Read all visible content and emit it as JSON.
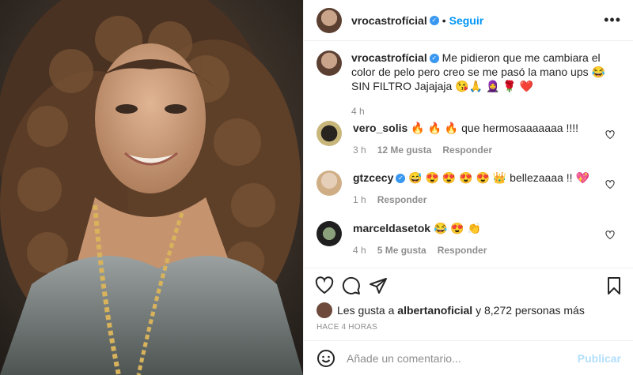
{
  "post": {
    "author": "vrocastrofícial",
    "follow_label": "Seguir",
    "dot": "•",
    "more": "•••"
  },
  "caption": {
    "username": "vrocastrofícial",
    "text": "Me pidieron que me cambiara el color de pelo pero creo se me pasó la mano ups 😂 SIN FILTRO Jajajaja 😘🙏 🧕 🌹 ❤️",
    "time": "4 h"
  },
  "comments": [
    {
      "username": "vero_solis",
      "text": "🔥 🔥 🔥  que hermosaaaaaaa !!!!",
      "time": "3 h",
      "likes": "12 Me gusta",
      "reply": "Responder"
    },
    {
      "username": "gtzcecy",
      "text": "😅 😍 😍 😍 😍 👑  bellezaaaa !! 💖",
      "time": "1 h",
      "likes": "",
      "reply": "Responder"
    },
    {
      "username": "marceldasetok",
      "text": "😂 😍 👏",
      "time": "4 h",
      "likes": "5 Me gusta",
      "reply": "Responder"
    }
  ],
  "likes": {
    "prefix": "Les gusta a",
    "user": "albertanoficial",
    "suffix": "y 8,272 personas más"
  },
  "posted_ago": "HACE 4 HORAS",
  "add_comment": {
    "placeholder": "Añade un comentario...",
    "publish_label": "Publicar"
  },
  "icons": [
    "heart-icon",
    "comment-icon",
    "share-icon",
    "bookmark-icon",
    "emoji-icon",
    "more-icon"
  ]
}
